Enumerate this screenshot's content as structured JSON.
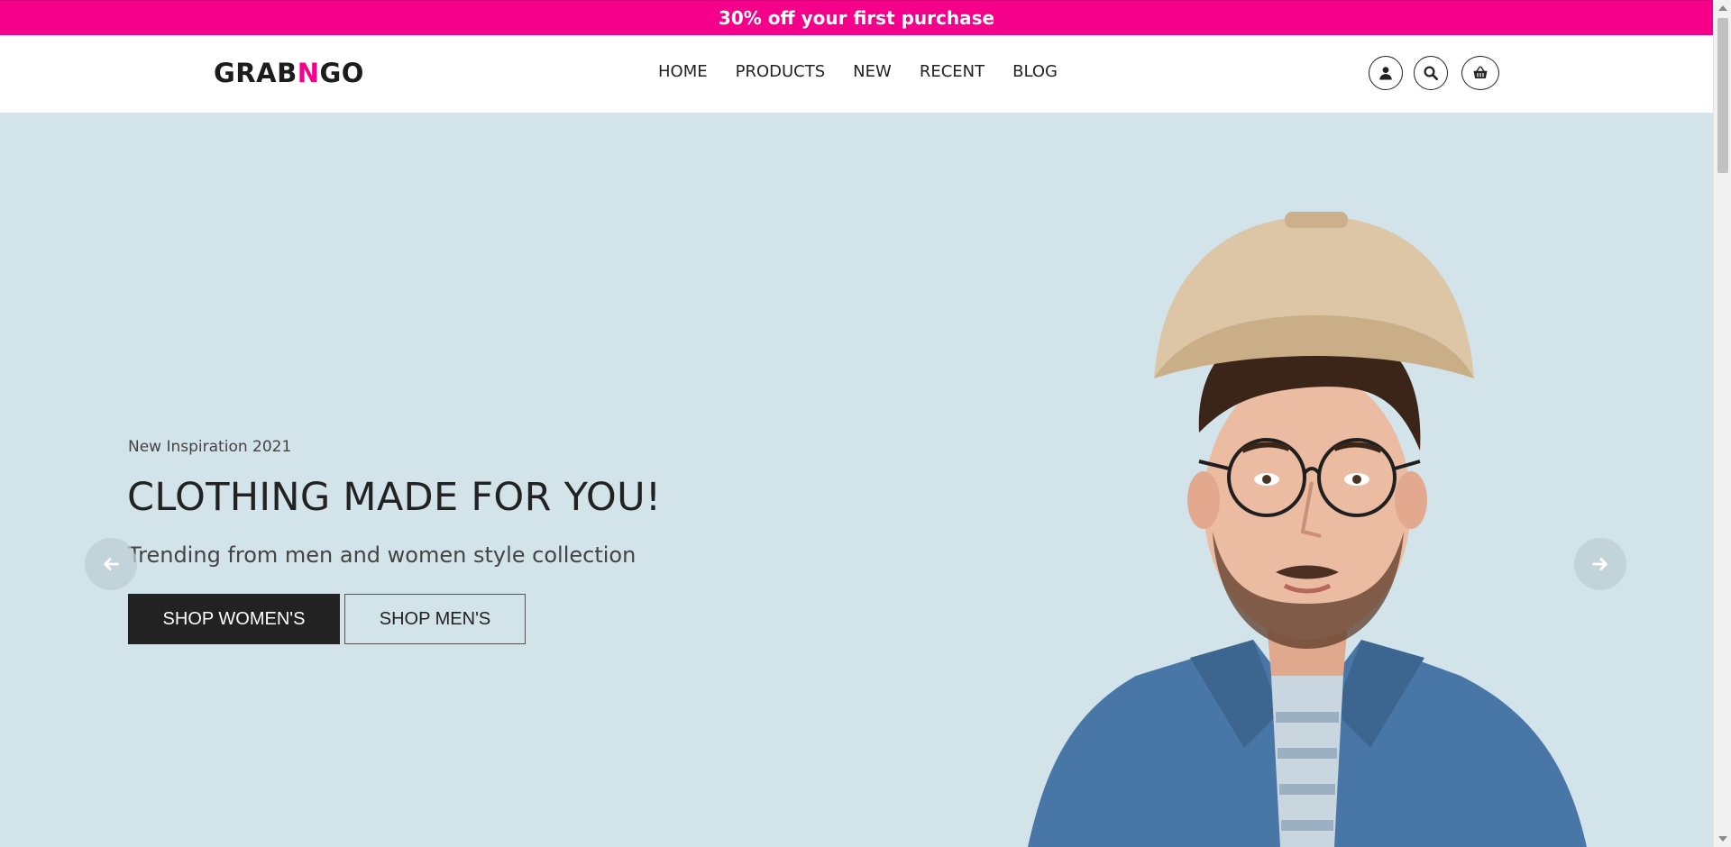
{
  "promo": {
    "text": "30% off your first purchase"
  },
  "header": {
    "logo": {
      "part1": "GRAB",
      "accent": "N",
      "part2": "GO"
    },
    "nav": [
      {
        "label": "HOME"
      },
      {
        "label": "PRODUCTS"
      },
      {
        "label": "NEW"
      },
      {
        "label": "RECENT"
      },
      {
        "label": "BLOG"
      }
    ],
    "icons": [
      "user-icon",
      "search-icon",
      "basket-icon"
    ]
  },
  "hero": {
    "eyebrow": "New Inspiration 2021",
    "title": "CLOTHING MADE FOR YOU!",
    "subtitle": "Trending from men and women style collection",
    "shop_women_label": "SHOP WOMEN'S",
    "shop_men_label": "SHOP MEN'S"
  },
  "colors": {
    "accent": "#f5008b",
    "hero_bg": "#d2e3ea",
    "dark": "#222222"
  }
}
